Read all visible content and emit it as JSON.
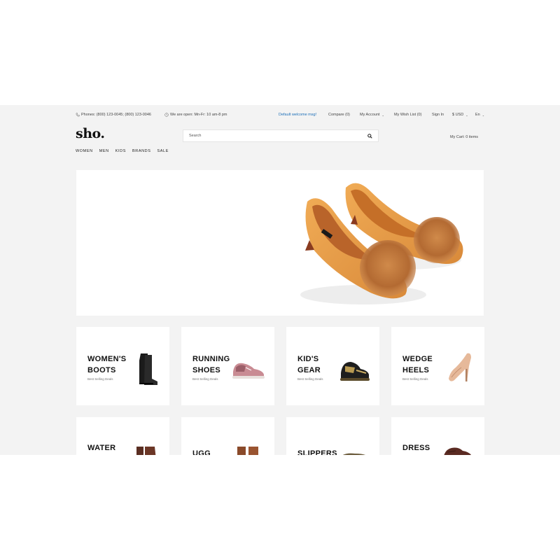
{
  "topbar": {
    "phones": "Phones: (800) 123-0045; (800) 123-0046",
    "hours": "We are open: Mn-Fr: 10 am-8 pm",
    "welcome": "Default welcome msg!",
    "compare": "Compare (0)",
    "my_account": "My Account",
    "wish_list": "My Wish List (0)",
    "sign_in": "Sign In",
    "currency": "$ USD",
    "language": "En"
  },
  "header": {
    "logo": "sho.",
    "search_placeholder": "Search",
    "cart": "My Cart: 0 items"
  },
  "nav": [
    "WOMEN",
    "MEN",
    "KIDS",
    "BRANDS",
    "SALE"
  ],
  "categories": [
    {
      "line1": "WOMEN'S",
      "line2": "BOOTS",
      "subtitle": "Best Selling Deals",
      "icon": "boot-icon"
    },
    {
      "line1": "RUNNING",
      "line2": "SHOES",
      "subtitle": "Best Selling Deals",
      "icon": "sneaker-icon"
    },
    {
      "line1": "KID'S",
      "line2": "GEAR",
      "subtitle": "Best Selling Deals",
      "icon": "kids-sneaker-icon"
    },
    {
      "line1": "WEDGE",
      "line2": "HEELS",
      "subtitle": "Best Selling Deals",
      "icon": "heel-icon"
    },
    {
      "line1": "WATER",
      "line2": "",
      "subtitle": "",
      "icon": "boot-icon"
    },
    {
      "line1": "",
      "line2": "UGG",
      "subtitle": "",
      "icon": "boot-icon"
    },
    {
      "line1": "",
      "line2": "SLIPPERS",
      "subtitle": "",
      "icon": "slipper-icon"
    },
    {
      "line1": "DRESS",
      "line2": "",
      "subtitle": "",
      "icon": "dress-shoe-icon"
    }
  ],
  "colors": {
    "accent": "#1d6fb8",
    "page_bg": "#f3f3f3",
    "hero_shoe": "#e09a45"
  }
}
